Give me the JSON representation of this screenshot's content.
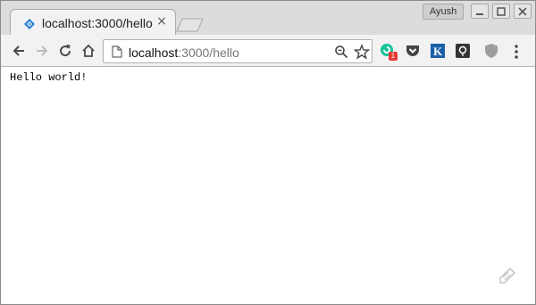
{
  "tab": {
    "title": "localhost:3000/hello",
    "close_glyph": "×",
    "favicon": "express-favicon-icon"
  },
  "window": {
    "profile_name": "Ayush"
  },
  "toolbar": {
    "url_host": "localhost",
    "url_rest": ":3000/hello",
    "extensions": [
      {
        "name": "grammarly-extension-icon",
        "badge": "1",
        "color": "#15c39a"
      },
      {
        "name": "pocket-extension-icon",
        "color": "#444444"
      },
      {
        "name": "kindle-extension-icon",
        "letter": "K",
        "color": "#1a5fa8"
      },
      {
        "name": "lightbulb-extension-icon",
        "color": "#333333"
      },
      {
        "name": "shield-extension-icon",
        "color": "#9e9e9e"
      }
    ]
  },
  "page": {
    "text": "Hello world!"
  },
  "colors": {
    "tabstrip": "#dcdcdc",
    "toolbar": "#f2f2f2",
    "favicon_blue": "#2a7fd4"
  }
}
